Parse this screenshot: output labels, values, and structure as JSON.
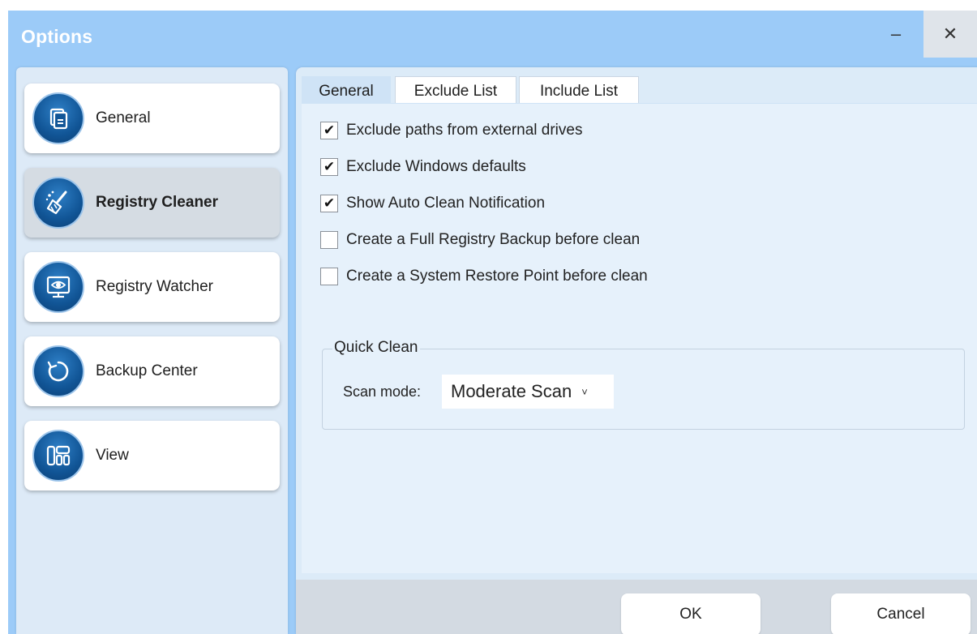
{
  "window": {
    "title": "Options",
    "minimize_glyph": "–",
    "close_glyph": "✕"
  },
  "sidebar": {
    "items": [
      {
        "label": "General",
        "icon": "document-icon",
        "active": false
      },
      {
        "label": "Registry Cleaner",
        "icon": "broom-icon",
        "active": true
      },
      {
        "label": "Registry Watcher",
        "icon": "monitor-eye-icon",
        "active": false
      },
      {
        "label": "Backup Center",
        "icon": "restore-icon",
        "active": false
      },
      {
        "label": "View",
        "icon": "layout-icon",
        "active": false
      }
    ]
  },
  "tabs": [
    {
      "label": "General",
      "active": true
    },
    {
      "label": "Exclude List",
      "active": false
    },
    {
      "label": "Include List",
      "active": false
    }
  ],
  "general": {
    "options": [
      {
        "label": "Exclude paths from external drives",
        "checked": true
      },
      {
        "label": "Exclude Windows defaults",
        "checked": true
      },
      {
        "label": "Show Auto Clean Notification",
        "checked": true
      },
      {
        "label": "Create a Full Registry Backup before clean",
        "checked": false
      },
      {
        "label": "Create a System Restore Point before clean",
        "checked": false
      }
    ],
    "check_mark": "✔",
    "quick_clean": {
      "title": "Quick Clean",
      "scan_mode_label": "Scan mode:",
      "scan_mode_value": "Moderate Scan",
      "chevron": "˅"
    }
  },
  "footer": {
    "ok_label": "OK",
    "cancel_label": "Cancel"
  },
  "colors": {
    "title_bar": "#9ccbf8",
    "sidebar_bg": "#ddeaf7",
    "icon_blue": "#115596",
    "active_tab": "#cfe3f6"
  }
}
